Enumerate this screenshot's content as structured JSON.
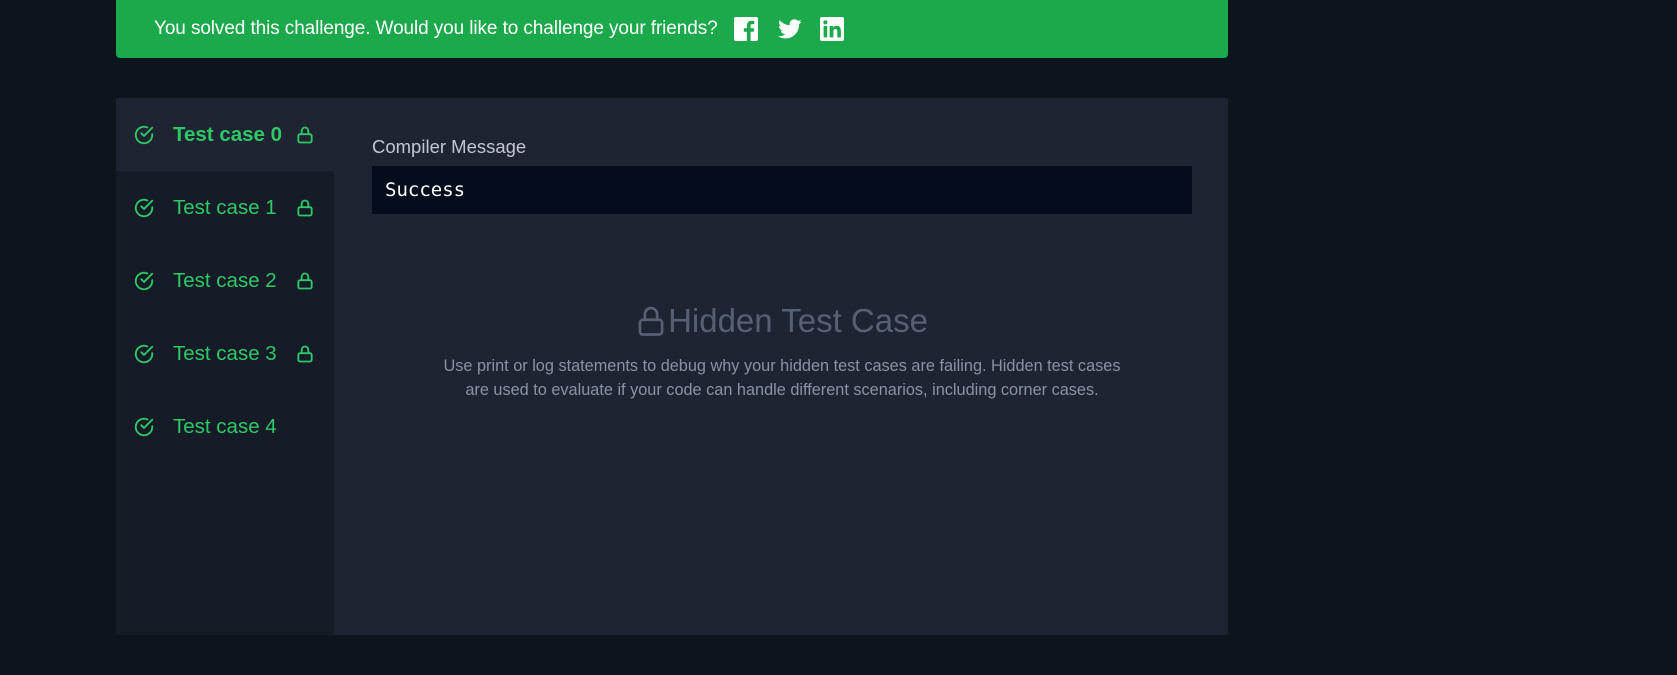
{
  "banner": {
    "message": "You solved this challenge. Would you like to challenge your friends?",
    "social": [
      {
        "icon": "facebook-icon"
      },
      {
        "icon": "twitter-icon"
      },
      {
        "icon": "linkedin-icon"
      }
    ]
  },
  "test_cases": [
    {
      "label": "Test case 0",
      "status": "passed",
      "locked": true,
      "active": true
    },
    {
      "label": "Test case 1",
      "status": "passed",
      "locked": true,
      "active": false
    },
    {
      "label": "Test case 2",
      "status": "passed",
      "locked": true,
      "active": false
    },
    {
      "label": "Test case 3",
      "status": "passed",
      "locked": true,
      "active": false
    },
    {
      "label": "Test case 4",
      "status": "passed",
      "locked": false,
      "active": false
    }
  ],
  "compiler": {
    "label": "Compiler Message",
    "message": "Success"
  },
  "hidden_case": {
    "title": "Hidden Test Case",
    "description": "Use print or log statements to debug why your hidden test cases are failing. Hidden test cases are used to evaluate if your code can handle different scenarios, including corner cases."
  },
  "colors": {
    "page_bg": "#0e141e",
    "banner_bg": "#1ba94c",
    "success_green": "#2ec866",
    "panel_bg": "#1e2432",
    "sidebar_bg": "#161b28",
    "console_bg": "#050c1b"
  }
}
